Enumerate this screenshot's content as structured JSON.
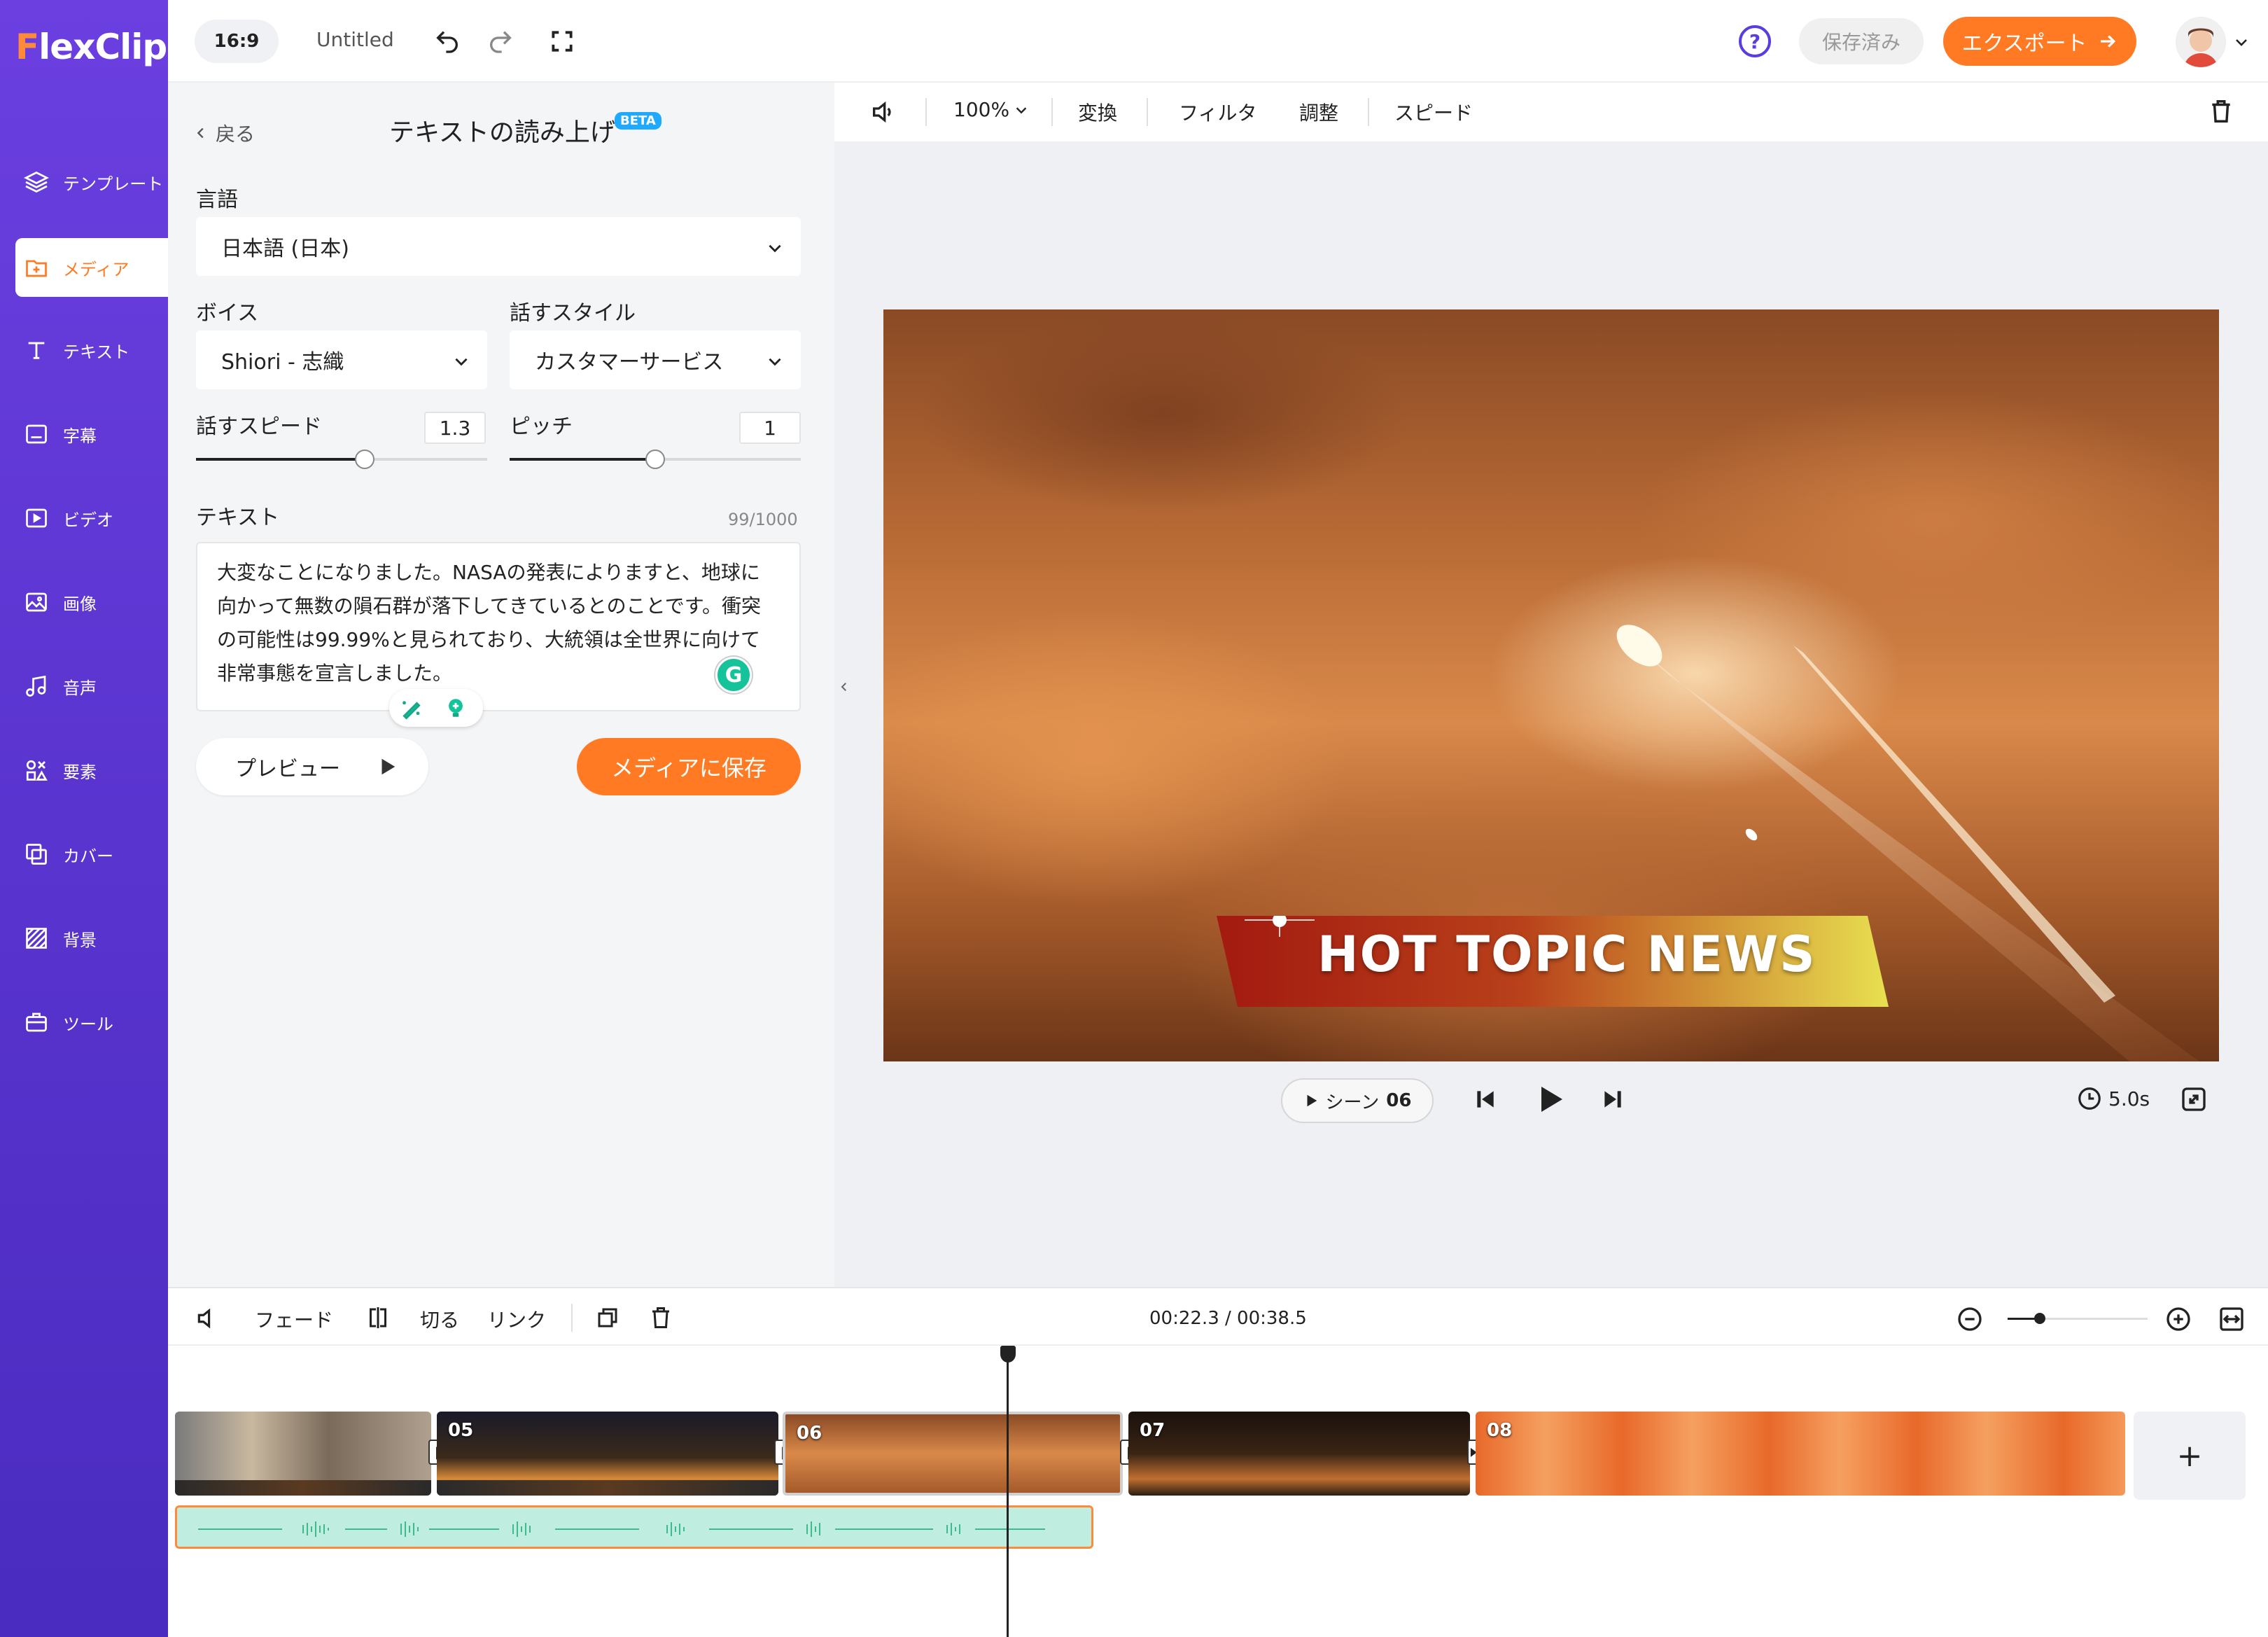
{
  "app": {
    "logo": "FlexClip",
    "logo_first": "F",
    "logo_rest": "lexClip"
  },
  "sidebar": {
    "items": [
      {
        "label": "テンプレート",
        "icon": "layers-icon"
      },
      {
        "label": "メディア",
        "icon": "folder-plus-icon",
        "active": true
      },
      {
        "label": "テキスト",
        "icon": "text-icon"
      },
      {
        "label": "字幕",
        "icon": "subtitle-icon"
      },
      {
        "label": "ビデオ",
        "icon": "video-icon"
      },
      {
        "label": "画像",
        "icon": "image-icon"
      },
      {
        "label": "音声",
        "icon": "music-icon"
      },
      {
        "label": "要素",
        "icon": "elements-icon"
      },
      {
        "label": "カバー",
        "icon": "cover-icon"
      },
      {
        "label": "背景",
        "icon": "background-icon"
      },
      {
        "label": "ツール",
        "icon": "toolbox-icon"
      }
    ]
  },
  "topbar": {
    "ratio": "16:9",
    "project_name": "Untitled",
    "help": "?",
    "saved_label": "保存済み",
    "export_label": "エクスポート"
  },
  "panel": {
    "back_label": "戻る",
    "title": "テキストの読み上げ",
    "beta": "BETA",
    "language_label": "言語",
    "language_value": "日本語 (日本)",
    "voice_label": "ボイス",
    "voice_value": "Shiori - 志織",
    "style_label": "話すスタイル",
    "style_value": "カスタマーサービス",
    "speed_label": "話すスピード",
    "speed_value": "1.3",
    "speed_fraction": 0.58,
    "pitch_label": "ピッチ",
    "pitch_value": "1",
    "pitch_fraction": 0.5,
    "text_label": "テキスト",
    "char_count": "99/1000",
    "text_lines": [
      "大変なことになりました。NASAの発表によりますと、地球に",
      "向かって無数の隕石群が落下してきているとのことです。衝突",
      "の可能性は99.99%と見られており、大統領は全世界に向けて",
      "非常事態を宣言しました。"
    ],
    "preview_label": "プレビュー",
    "save_label": "メディアに保存"
  },
  "editor": {
    "volume": "volume-icon",
    "zoom": "100%",
    "tools": [
      "変換",
      "フィルタ",
      "調整",
      "スピード"
    ],
    "banner_text": "HOT TOPIC NEWS",
    "scene_label": "シーン",
    "scene_number": "06",
    "duration": "5.0s"
  },
  "timeline": {
    "tools": [
      "フェード",
      "切る",
      "リンク"
    ],
    "timecode": "00:22.3 / 00:38.5",
    "zoom_fraction": 0.23,
    "clips": [
      {
        "num": "",
        "color": "#6a6a6a"
      },
      {
        "num": "05",
        "color": "#3a2a1a"
      },
      {
        "num": "06",
        "color": "#b8672e"
      },
      {
        "num": "07",
        "color": "#2b1d12"
      },
      {
        "num": "08",
        "color": "#e8692a"
      }
    ],
    "add_label": "+"
  },
  "colors": {
    "accent": "#ff7a22",
    "sidebar": "#5a34cf",
    "audio": "#bfeee0"
  }
}
